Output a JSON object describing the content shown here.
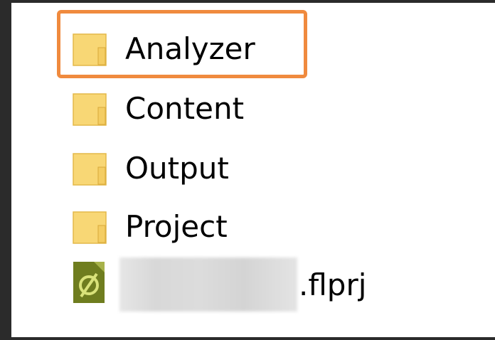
{
  "items": [
    {
      "type": "folder",
      "name": "Analyzer",
      "icon": "folder-icon",
      "highlighted": true
    },
    {
      "type": "folder",
      "name": "Content",
      "icon": "folder-icon"
    },
    {
      "type": "folder",
      "name": "Output",
      "icon": "folder-icon"
    },
    {
      "type": "folder",
      "name": "Project",
      "icon": "folder-icon"
    },
    {
      "type": "file",
      "name_suffix": ".flprj",
      "icon": "flare-project-icon",
      "name_blurred": true
    }
  ],
  "colors": {
    "background": "#2b2b2b",
    "panel": "#ffffff",
    "highlight": "#f08a3e",
    "folder": "#f8d775",
    "project_icon": "#6f7d1f"
  }
}
